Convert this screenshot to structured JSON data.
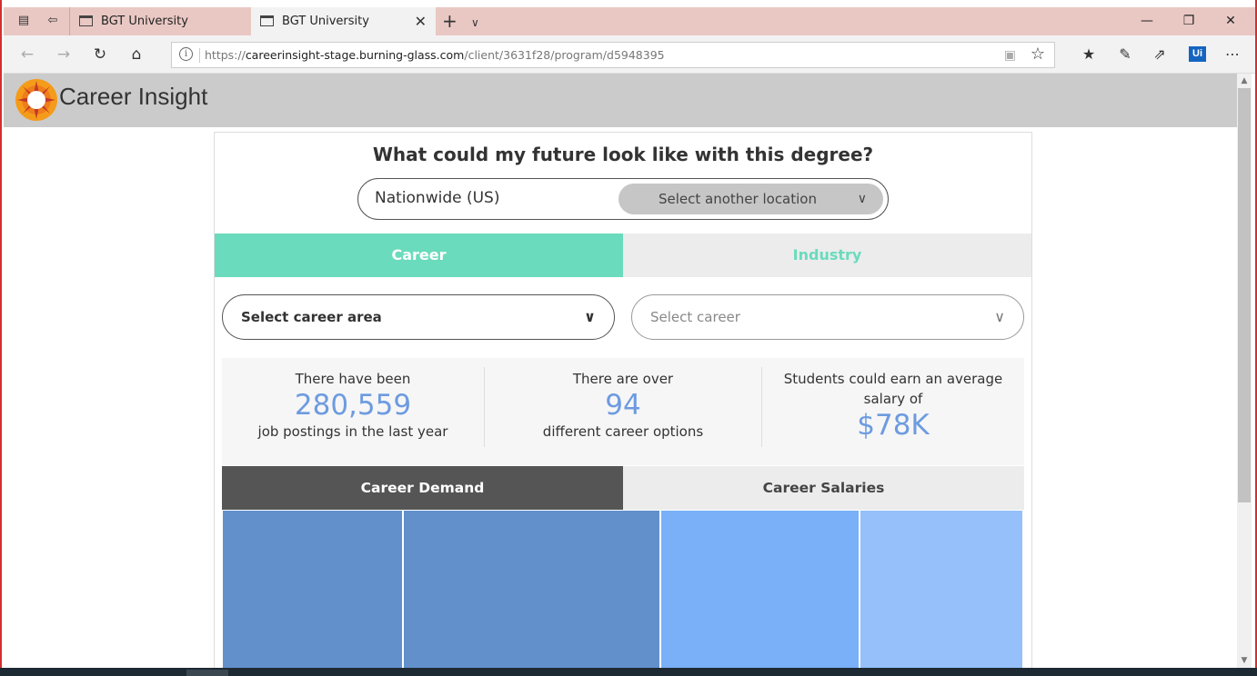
{
  "browser": {
    "tabs": [
      {
        "title": "BGT University",
        "active": false
      },
      {
        "title": "BGT University",
        "active": true
      }
    ],
    "address": {
      "host_prefix": "https://",
      "host": "careerinsight-stage.burning-glass.com",
      "path": "/client/3631f28/program/d5948395"
    },
    "toolbar_icons": [
      "favorites-bar-icon",
      "notes-pen-icon",
      "share-icon",
      "ui-extension-icon",
      "more-icon"
    ],
    "extension_badge": "Ui"
  },
  "app": {
    "brand": "Career Insight",
    "question": "What could my future look like with this degree?",
    "location": {
      "current": "Nationwide (US)",
      "select_label": "Select another location"
    },
    "top_tabs": [
      {
        "label": "Career",
        "active": true
      },
      {
        "label": "Industry",
        "active": false
      }
    ],
    "selects": {
      "career_area": "Select career area",
      "career": "Select career"
    },
    "stats": [
      {
        "pre": "There have been",
        "value": "280,559",
        "post": "job postings in the last year"
      },
      {
        "pre": "There are over",
        "value": "94",
        "post": "different career options"
      },
      {
        "pre": "Students could earn an average salary of",
        "value": "$78K",
        "post": ""
      }
    ],
    "sub_tabs": [
      {
        "label": "Career Demand",
        "active": true
      },
      {
        "label": "Career Salaries",
        "active": false
      }
    ],
    "treemap_colors": [
      "#6290cb",
      "#6290cb",
      "#79b0f8",
      "#95c0fa"
    ]
  },
  "colors": {
    "accent": "#6adbbd",
    "stat_value": "#6d9be0",
    "window_border": "#d32f2f"
  }
}
